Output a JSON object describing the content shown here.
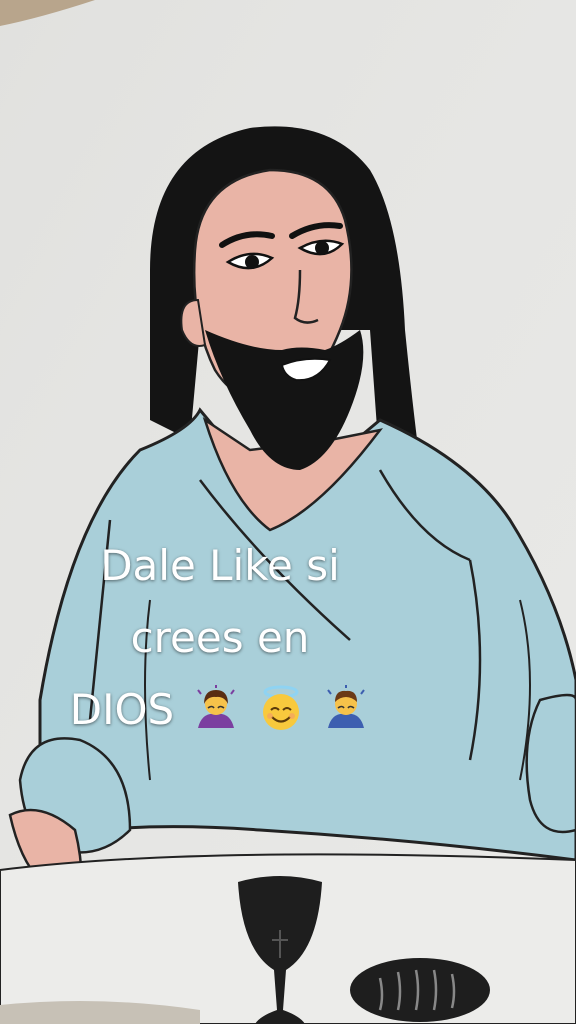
{
  "caption": {
    "line1": "Dale Like si",
    "line2": "crees en",
    "line3": "DIOS"
  },
  "emojis": [
    "woman-bowing-icon",
    "smiling-face-with-halo-icon",
    "man-bowing-icon"
  ],
  "colors": {
    "wall": "#e6e6e4",
    "robe": "#a9cfd9",
    "skin": "#e9b4a6",
    "hair": "#111111",
    "caption_text": "#ffffff"
  }
}
